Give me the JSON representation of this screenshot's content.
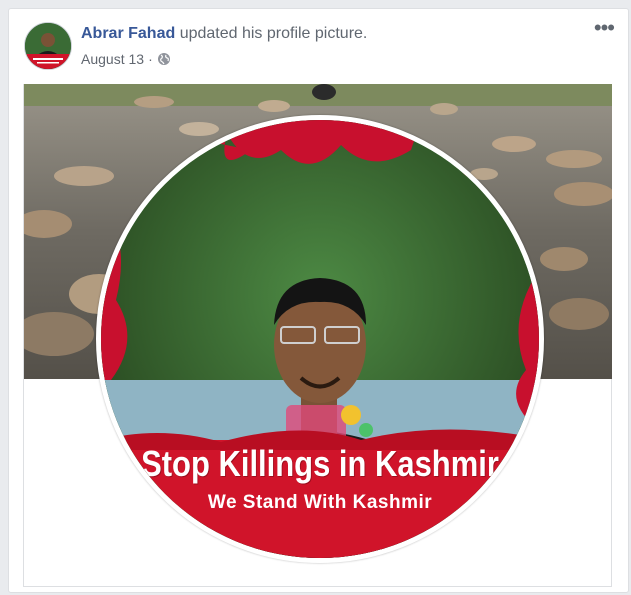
{
  "post": {
    "author": "Abrar Fahad",
    "action": " updated his profile picture.",
    "date": "August 13",
    "separator": " · ",
    "privacy_icon": "globe-icon",
    "more_icon": "ellipsis-icon"
  },
  "profile_picture": {
    "title": "Stop Killings in Kashmir",
    "subtitle": "We Stand With Kashmir"
  },
  "colors": {
    "link": "#385898",
    "banner_red": "#d0142a"
  }
}
